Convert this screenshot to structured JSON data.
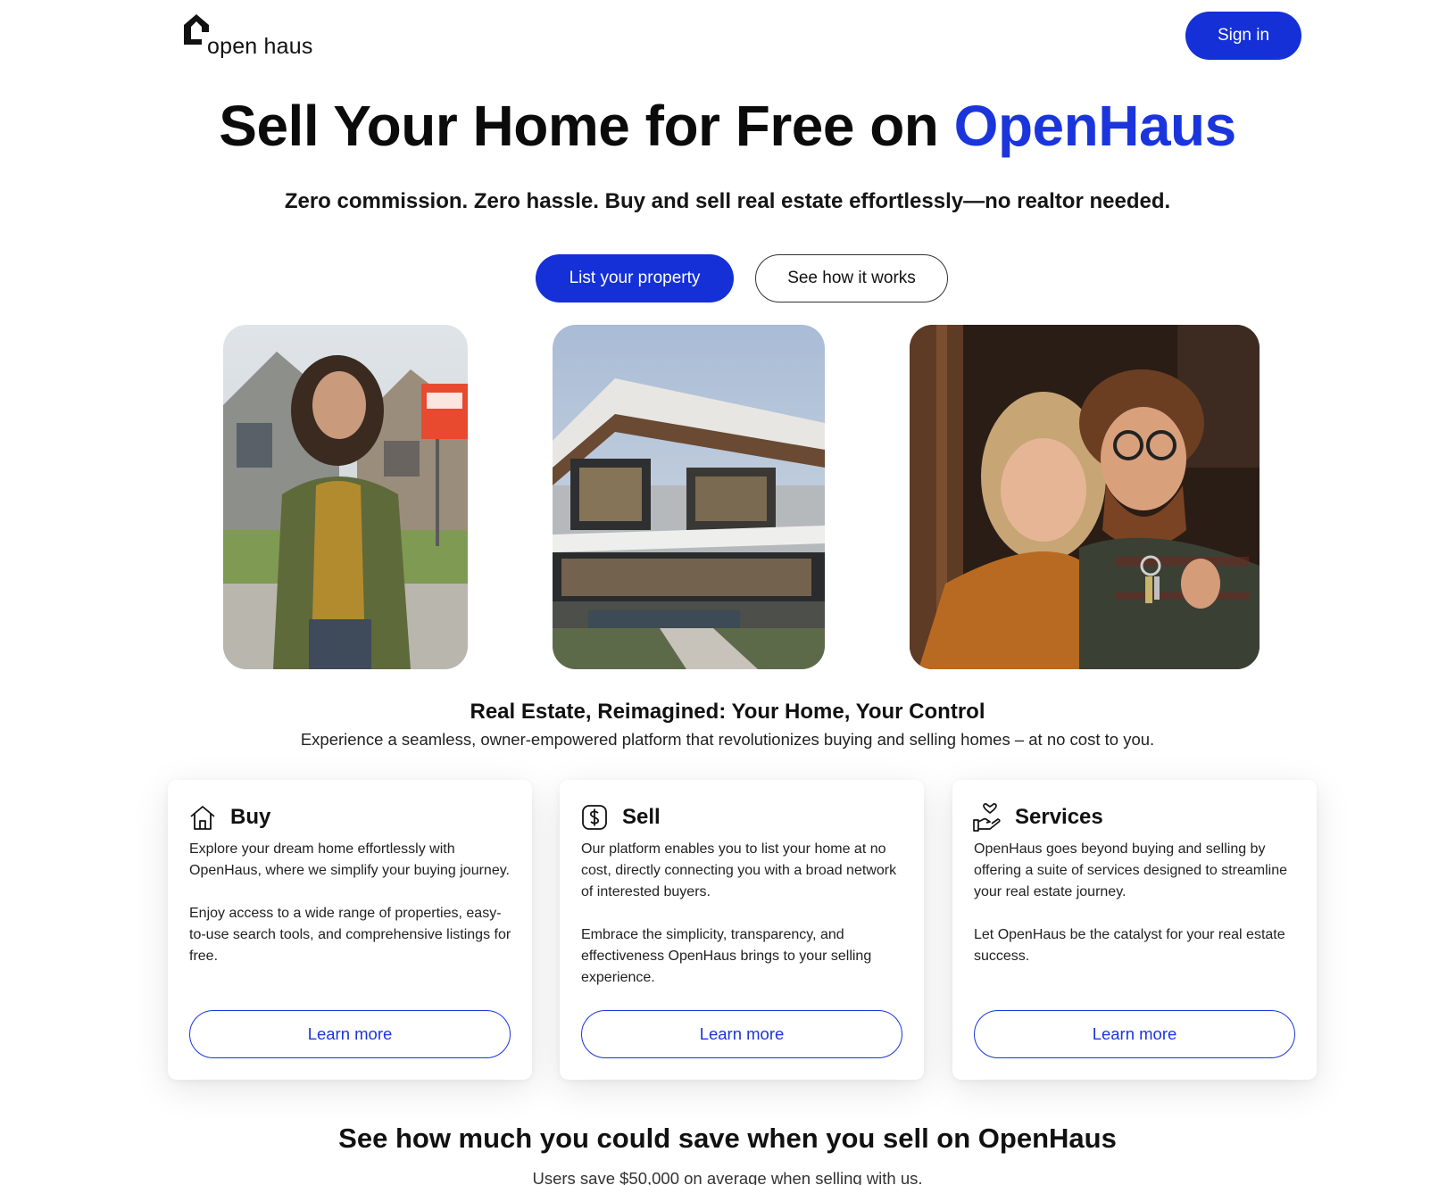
{
  "header": {
    "logo_text": "open haus",
    "signin_label": "Sign in"
  },
  "hero": {
    "title_main": "Sell Your Home for Free on ",
    "title_accent": "OpenHaus",
    "subtitle": "Zero commission. Zero hassle. Buy and sell real estate effortlessly—no realtor needed.",
    "primary_button": "List your property",
    "secondary_button": "See how it works"
  },
  "photos": [
    {
      "icon": "woman-with-sold-sign-photo"
    },
    {
      "icon": "modern-house-photo"
    },
    {
      "icon": "couple-with-keys-photo"
    }
  ],
  "intro": {
    "title": "Real Estate, Reimagined: Your Home, Your Control",
    "subtitle": "Experience a seamless, owner-empowered platform that revolutionizes buying and selling homes – at no cost to you."
  },
  "cards": [
    {
      "icon": "house-icon",
      "title": "Buy",
      "paragraphs": [
        "Explore your dream home effortlessly with OpenHaus, where we simplify your buying journey.",
        "Enjoy access to a wide range of properties, easy-to-use search tools, and comprehensive listings for free."
      ],
      "button": "Learn more"
    },
    {
      "icon": "dollar-icon",
      "title": "Sell",
      "paragraphs": [
        "Our platform enables you to list your home at no cost, directly connecting you with a broad network of interested buyers.",
        "Embrace the simplicity, transparency, and effectiveness OpenHaus brings to your selling experience."
      ],
      "button": "Learn more"
    },
    {
      "icon": "hand-heart-icon",
      "title": "Services",
      "paragraphs": [
        "OpenHaus goes beyond buying and selling by offering a suite of services designed to streamline your real estate journey.",
        "Let OpenHaus be the catalyst for your real estate success."
      ],
      "button": "Learn more"
    }
  ],
  "savings": {
    "title": "See how much you could save when you sell on OpenHaus",
    "subtitle": "Users save $50,000 on average when selling with us."
  },
  "colors": {
    "brand_blue": "#1430d6",
    "accent_blue": "#1a35dc"
  }
}
